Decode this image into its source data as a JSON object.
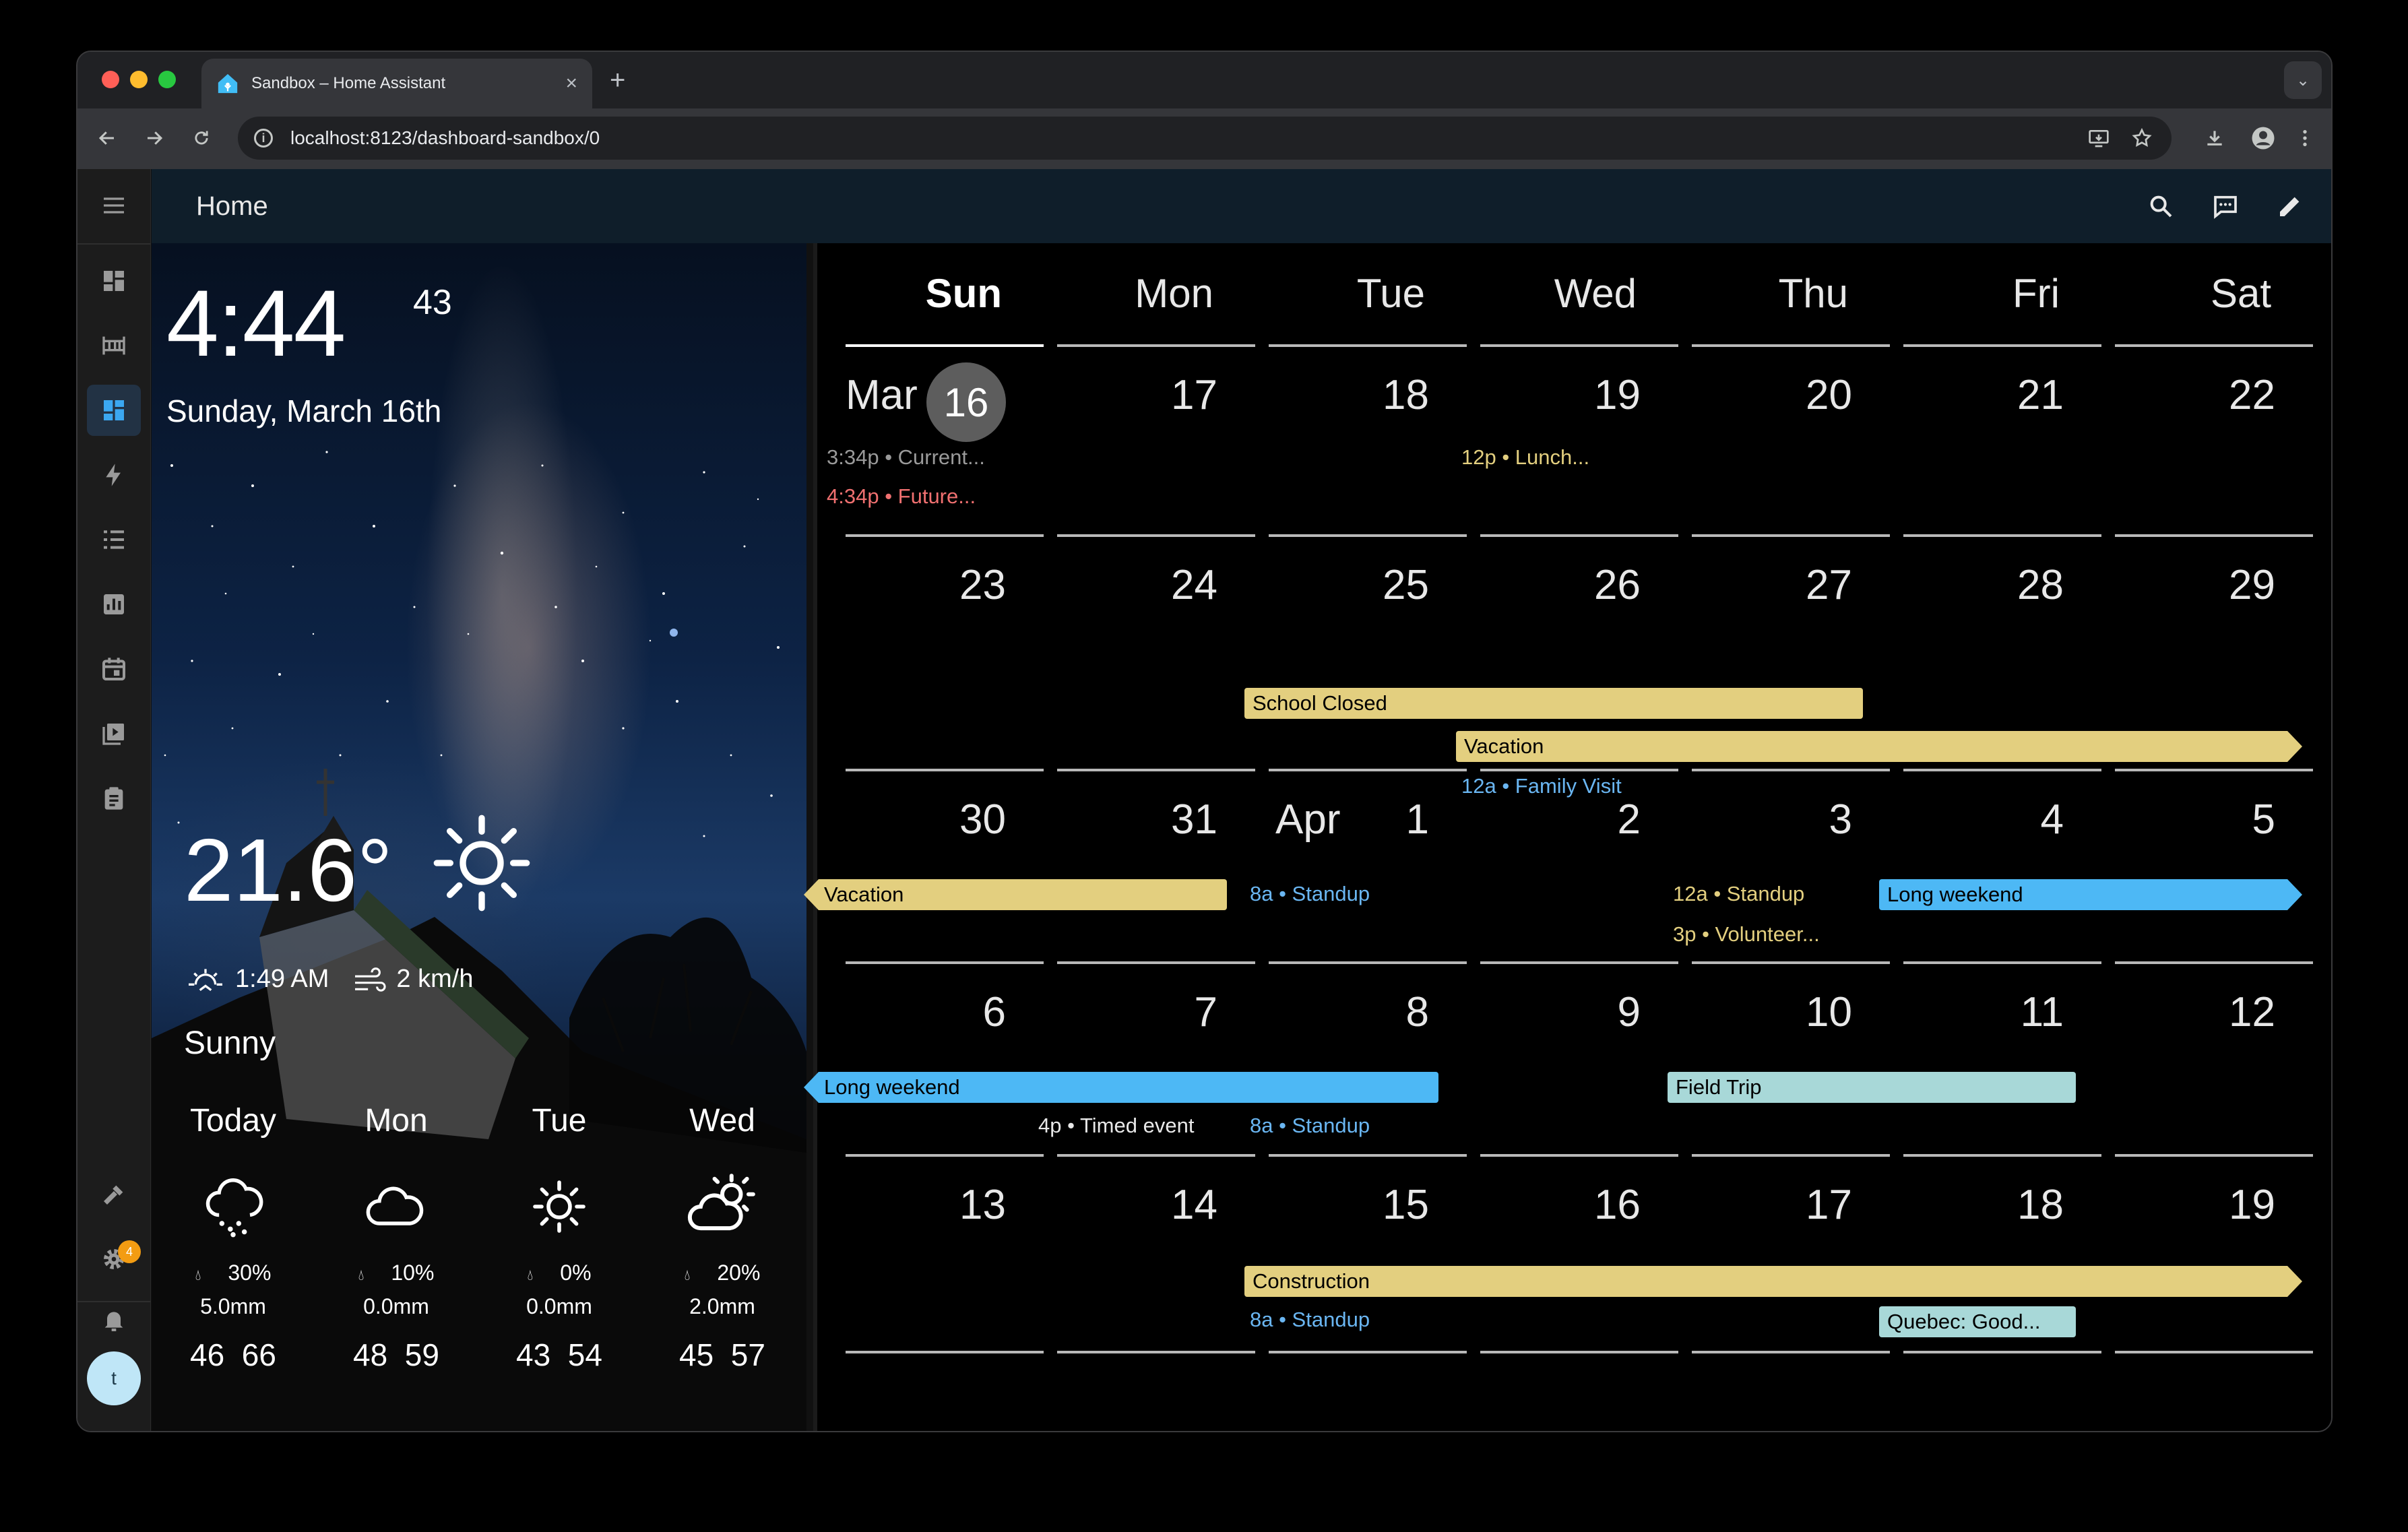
{
  "browser": {
    "tab_title": "Sandbox – Home Assistant",
    "url": "localhost:8123/dashboard-sandbox/0",
    "traffic_colors": [
      "#ff5f57",
      "#febc2e",
      "#28c840"
    ]
  },
  "header": {
    "title": "Home"
  },
  "sidebar": {
    "items": [
      "overview-icon",
      "map-icon",
      "dashboard-icon",
      "energy-icon",
      "todo-icon",
      "history-icon",
      "calendar-icon",
      "media-icon",
      "logbook-icon"
    ],
    "active": "dashboard-icon",
    "bottom": [
      "developer-tools-icon",
      "settings-icon",
      "notifications-icon"
    ],
    "settings_badge": "4",
    "avatar_initial": "t"
  },
  "clock": {
    "time": "4:44",
    "seconds": "43",
    "date": "Sunday, March 16th"
  },
  "weather": {
    "temperature": "21.6°",
    "sunrise": "1:49 AM",
    "wind": "2 km/h",
    "condition": "Sunny",
    "forecast": [
      {
        "day": "Today",
        "icon": "snowy-rainy-icon",
        "precip_prob": "30%",
        "precip": "5.0mm",
        "low": "46",
        "high": "66"
      },
      {
        "day": "Mon",
        "icon": "cloudy-icon",
        "precip_prob": "10%",
        "precip": "0.0mm",
        "low": "48",
        "high": "59"
      },
      {
        "day": "Tue",
        "icon": "sunny-icon",
        "precip_prob": "0%",
        "precip": "0.0mm",
        "low": "43",
        "high": "54"
      },
      {
        "day": "Wed",
        "icon": "partly-cloudy-icon",
        "precip_prob": "20%",
        "precip": "2.0mm",
        "low": "45",
        "high": "57"
      }
    ]
  },
  "calendar": {
    "days_of_week": [
      "Sun",
      "Mon",
      "Tue",
      "Wed",
      "Thu",
      "Fri",
      "Sat"
    ],
    "weeks": [
      [
        "16",
        "17",
        "18",
        "19",
        "20",
        "21",
        "22"
      ],
      [
        "23",
        "24",
        "25",
        "26",
        "27",
        "28",
        "29"
      ],
      [
        "30",
        "31",
        "1",
        "2",
        "3",
        "4",
        "5"
      ],
      [
        "6",
        "7",
        "8",
        "9",
        "10",
        "11",
        "12"
      ],
      [
        "13",
        "14",
        "15",
        "16",
        "17",
        "18",
        "19"
      ]
    ],
    "month_labels": {
      "mar": "Mar",
      "apr": "Apr"
    },
    "colors": {
      "yellow": "#e3cf7f",
      "blue": "#4db8f5",
      "teal": "#a8d8d8",
      "blue_text": "#6ab6f2",
      "red_text": "#f07070",
      "yellow_text": "#e3cf7f",
      "gray_text": "#9a9a9a"
    },
    "events": {
      "w1_current": "3:34p • Current...",
      "w1_future": "4:34p • Future...",
      "w1_lunch": "12p • Lunch...",
      "w2_school": "School Closed",
      "w2_vacation": "Vacation",
      "w2_family": "12a • Family Visit",
      "w3_vacation": "Vacation",
      "w3_standup": "8a • Standup",
      "w3_standup2": "12a • Standup",
      "w3_volunteer": "3p • Volunteer...",
      "w3_longweekend": "Long weekend",
      "w4_longweekend": "Long weekend",
      "w4_timed": "4p • Timed event",
      "w4_standup": "8a • Standup",
      "w4_fieldtrip": "Field Trip",
      "w5_construction": "Construction",
      "w5_standup": "8a • Standup",
      "w5_quebec": "Quebec: Good..."
    }
  }
}
